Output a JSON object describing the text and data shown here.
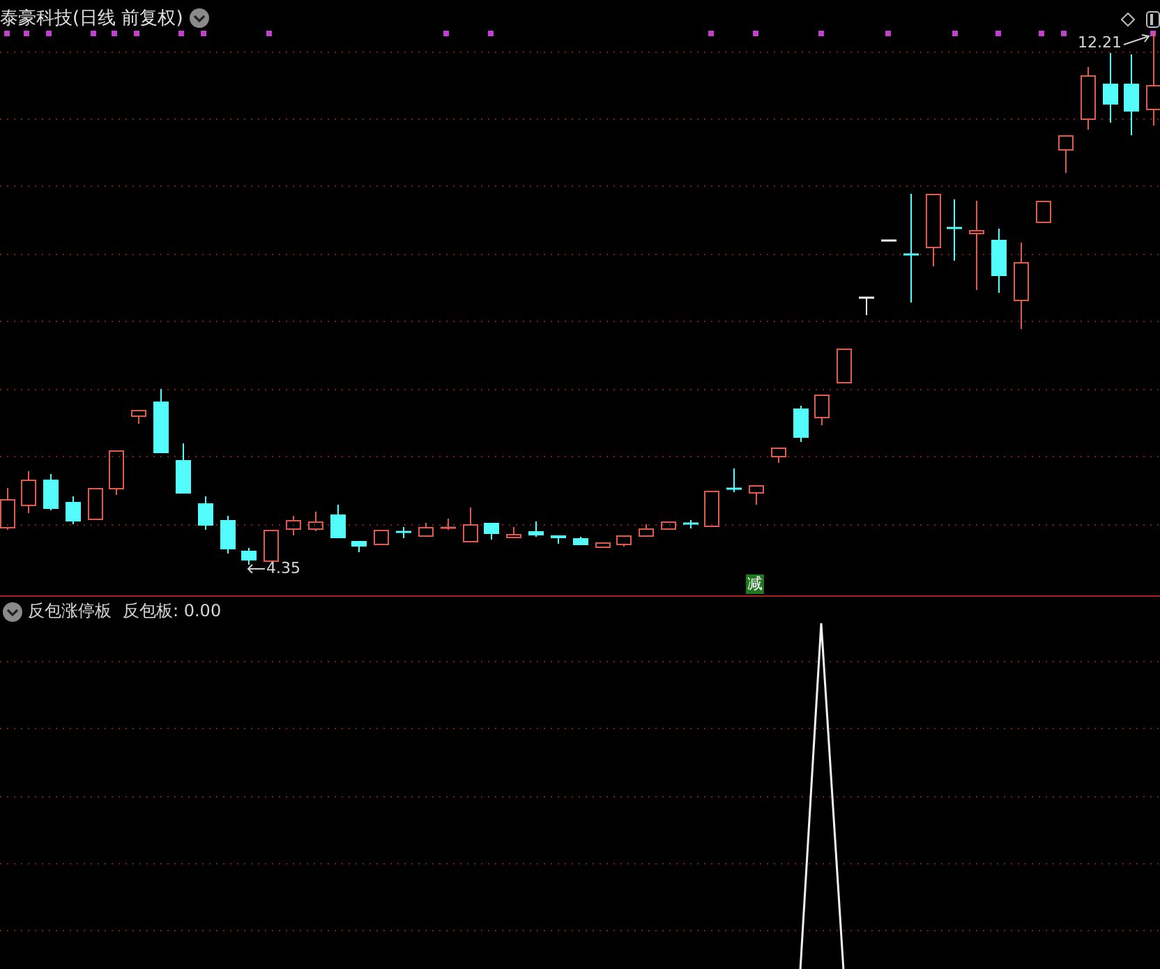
{
  "chart": {
    "title": "泰豪科技(日线 前复权)",
    "high_label": "12.21",
    "low_label": "4.35",
    "signal_badge": "减"
  },
  "indicator": {
    "name": "反包涨停板",
    "reading": "反包板: 0.00"
  }
}
